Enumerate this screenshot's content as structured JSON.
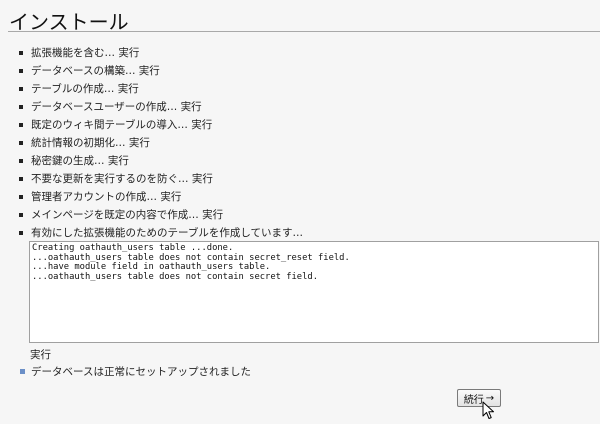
{
  "title": "インストール",
  "steps": [
    {
      "label": "拡張機能を含む… 実行"
    },
    {
      "label": "データベースの構築… 実行"
    },
    {
      "label": "テーブルの作成… 実行"
    },
    {
      "label": "データベースユーザーの作成… 実行"
    },
    {
      "label": "既定のウィキ間テーブルの導入… 実行"
    },
    {
      "label": "統計情報の初期化… 実行"
    },
    {
      "label": "秘密鍵の生成… 実行"
    },
    {
      "label": "不要な更新を実行するのを防ぐ… 実行"
    },
    {
      "label": "管理者アカウントの作成… 実行"
    },
    {
      "label": "メインページを既定の内容で作成… 実行"
    },
    {
      "label": "有効にした拡張機能のためのテーブルを作成しています…"
    }
  ],
  "log": [
    "Creating oathauth_users table ...done.",
    "...oathauth_users table does not contain secret_reset field.",
    "...have module field in oathauth_users table.",
    "...oathauth_users table does not contain secret field."
  ],
  "done_label": "実行",
  "success_message": "データベースは正常にセットアップされました",
  "continue_button": {
    "label": "続行",
    "arrow": "→"
  },
  "colors": {
    "background": "#f6f6f6",
    "success_bullet": "#6b8fc7"
  }
}
